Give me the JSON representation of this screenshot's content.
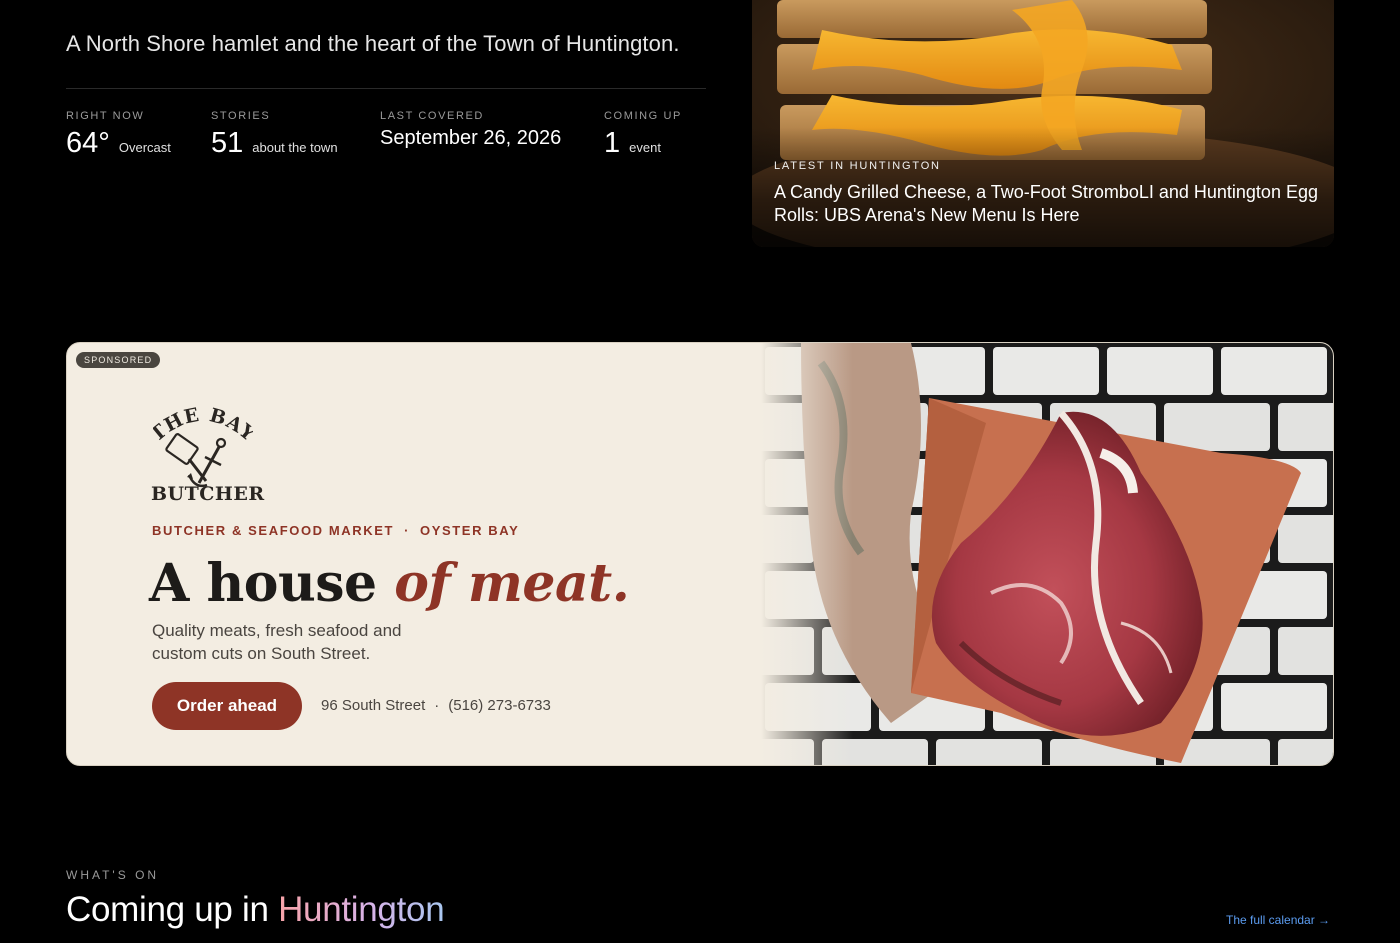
{
  "hero": {
    "tagline": "A North Shore hamlet and the heart of the Town of Huntington."
  },
  "stats": [
    {
      "label": "RIGHT NOW",
      "value": "64°",
      "detail": "Overcast"
    },
    {
      "label": "STORIES",
      "value": "51",
      "detail": "about the town"
    },
    {
      "label": "LAST COVERED",
      "value": "September 26, 2026"
    },
    {
      "label": "COMING UP",
      "value": "1",
      "detail": "event"
    }
  ],
  "latest": {
    "kicker": "LATEST IN HUNTINGTON",
    "headline": "A Candy Grilled Cheese, a Two-Foot StromboLI and Huntington Egg Rolls: UBS Arena's New Menu Is Here"
  },
  "ad": {
    "badge": "SPONSORED",
    "logo_top": "THE BAY",
    "logo_bottom": "BUTCHER",
    "eyebrow_left": "BUTCHER & SEAFOOD MARKET",
    "eyebrow_sep": "·",
    "eyebrow_right": "OYSTER BAY",
    "headline_plain": "A house",
    "headline_accent": "of meat.",
    "body": "Quality meats, fresh seafood and custom cuts on South Street.",
    "cta": "Order ahead",
    "address": "96 South Street",
    "contact_sep": "·",
    "phone": "(516) 273-6733"
  },
  "whats_on": {
    "kicker": "WHAT'S ON",
    "title_plain": "Coming up in",
    "title_accent": "Huntington",
    "calendar_link": "The full calendar →"
  },
  "colors": {
    "background": "#000000",
    "ad_background": "#f3ede2",
    "ad_accent": "#8e3426",
    "link": "#5b9cf0"
  },
  "icons": [
    "anchor-cleaver-logo-icon"
  ]
}
